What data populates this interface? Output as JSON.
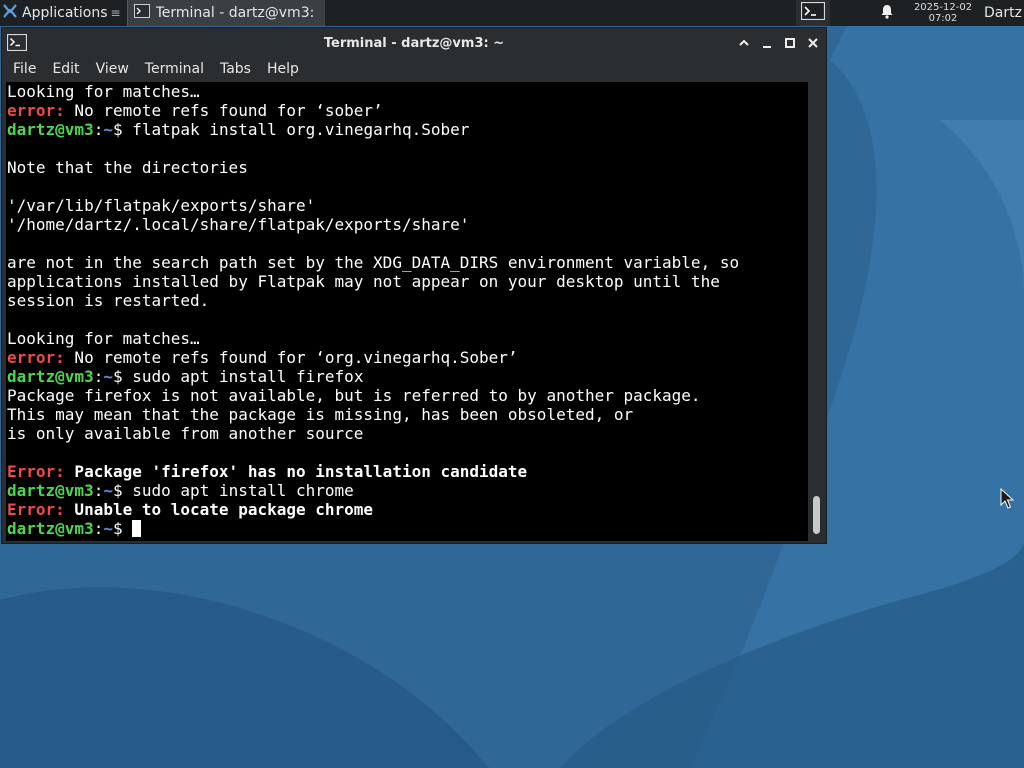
{
  "panel": {
    "applications_label": "Applications",
    "applications_more": "≡",
    "task_label": "Terminal - dartz@vm3: ~",
    "clock_date": "2025-12-02",
    "clock_time": "07:02",
    "user": "Dartz"
  },
  "window": {
    "title": "Terminal - dartz@vm3: ~"
  },
  "menu": [
    "File",
    "Edit",
    "View",
    "Terminal",
    "Tabs",
    "Help"
  ],
  "terminal": {
    "prompt_user": "dartz@vm3",
    "prompt_sep": ":",
    "prompt_path": "~",
    "prompt_symbol": "$",
    "lines": [
      {
        "type": "text",
        "text": "Looking for matches…"
      },
      {
        "type": "error",
        "label": "error:",
        "msg": " No remote refs found for ‘sober’",
        "bold": false
      },
      {
        "type": "prompt",
        "cmd": " flatpak install org.vinegarhq.Sober"
      },
      {
        "type": "text",
        "text": ""
      },
      {
        "type": "text",
        "text": "Note that the directories"
      },
      {
        "type": "text",
        "text": ""
      },
      {
        "type": "text",
        "text": "'/var/lib/flatpak/exports/share'"
      },
      {
        "type": "text",
        "text": "'/home/dartz/.local/share/flatpak/exports/share'"
      },
      {
        "type": "text",
        "text": ""
      },
      {
        "type": "text",
        "text": "are not in the search path set by the XDG_DATA_DIRS environment variable, so"
      },
      {
        "type": "text",
        "text": "applications installed by Flatpak may not appear on your desktop until the"
      },
      {
        "type": "text",
        "text": "session is restarted."
      },
      {
        "type": "text",
        "text": ""
      },
      {
        "type": "text",
        "text": "Looking for matches…"
      },
      {
        "type": "error",
        "label": "error:",
        "msg": " No remote refs found for ‘org.vinegarhq.Sober’",
        "bold": false
      },
      {
        "type": "prompt",
        "cmd": " sudo apt install firefox"
      },
      {
        "type": "text",
        "text": "Package firefox is not available, but is referred to by another package."
      },
      {
        "type": "text",
        "text": "This may mean that the package is missing, has been obsoleted, or"
      },
      {
        "type": "text",
        "text": "is only available from another source"
      },
      {
        "type": "text",
        "text": ""
      },
      {
        "type": "error",
        "label": "Error:",
        "msg": " Package 'firefox' has no installation candidate",
        "bold": true
      },
      {
        "type": "prompt",
        "cmd": " sudo apt install chrome"
      },
      {
        "type": "error",
        "label": "Error:",
        "msg": " Unable to locate package chrome",
        "bold": true
      },
      {
        "type": "prompt",
        "cmd": " ",
        "cursor": true
      }
    ]
  },
  "colors": {
    "desktop": "#2f6796",
    "error": "#ef4b4b",
    "prompt_user": "#4ad94a",
    "prompt_path": "#5b8ee6"
  }
}
